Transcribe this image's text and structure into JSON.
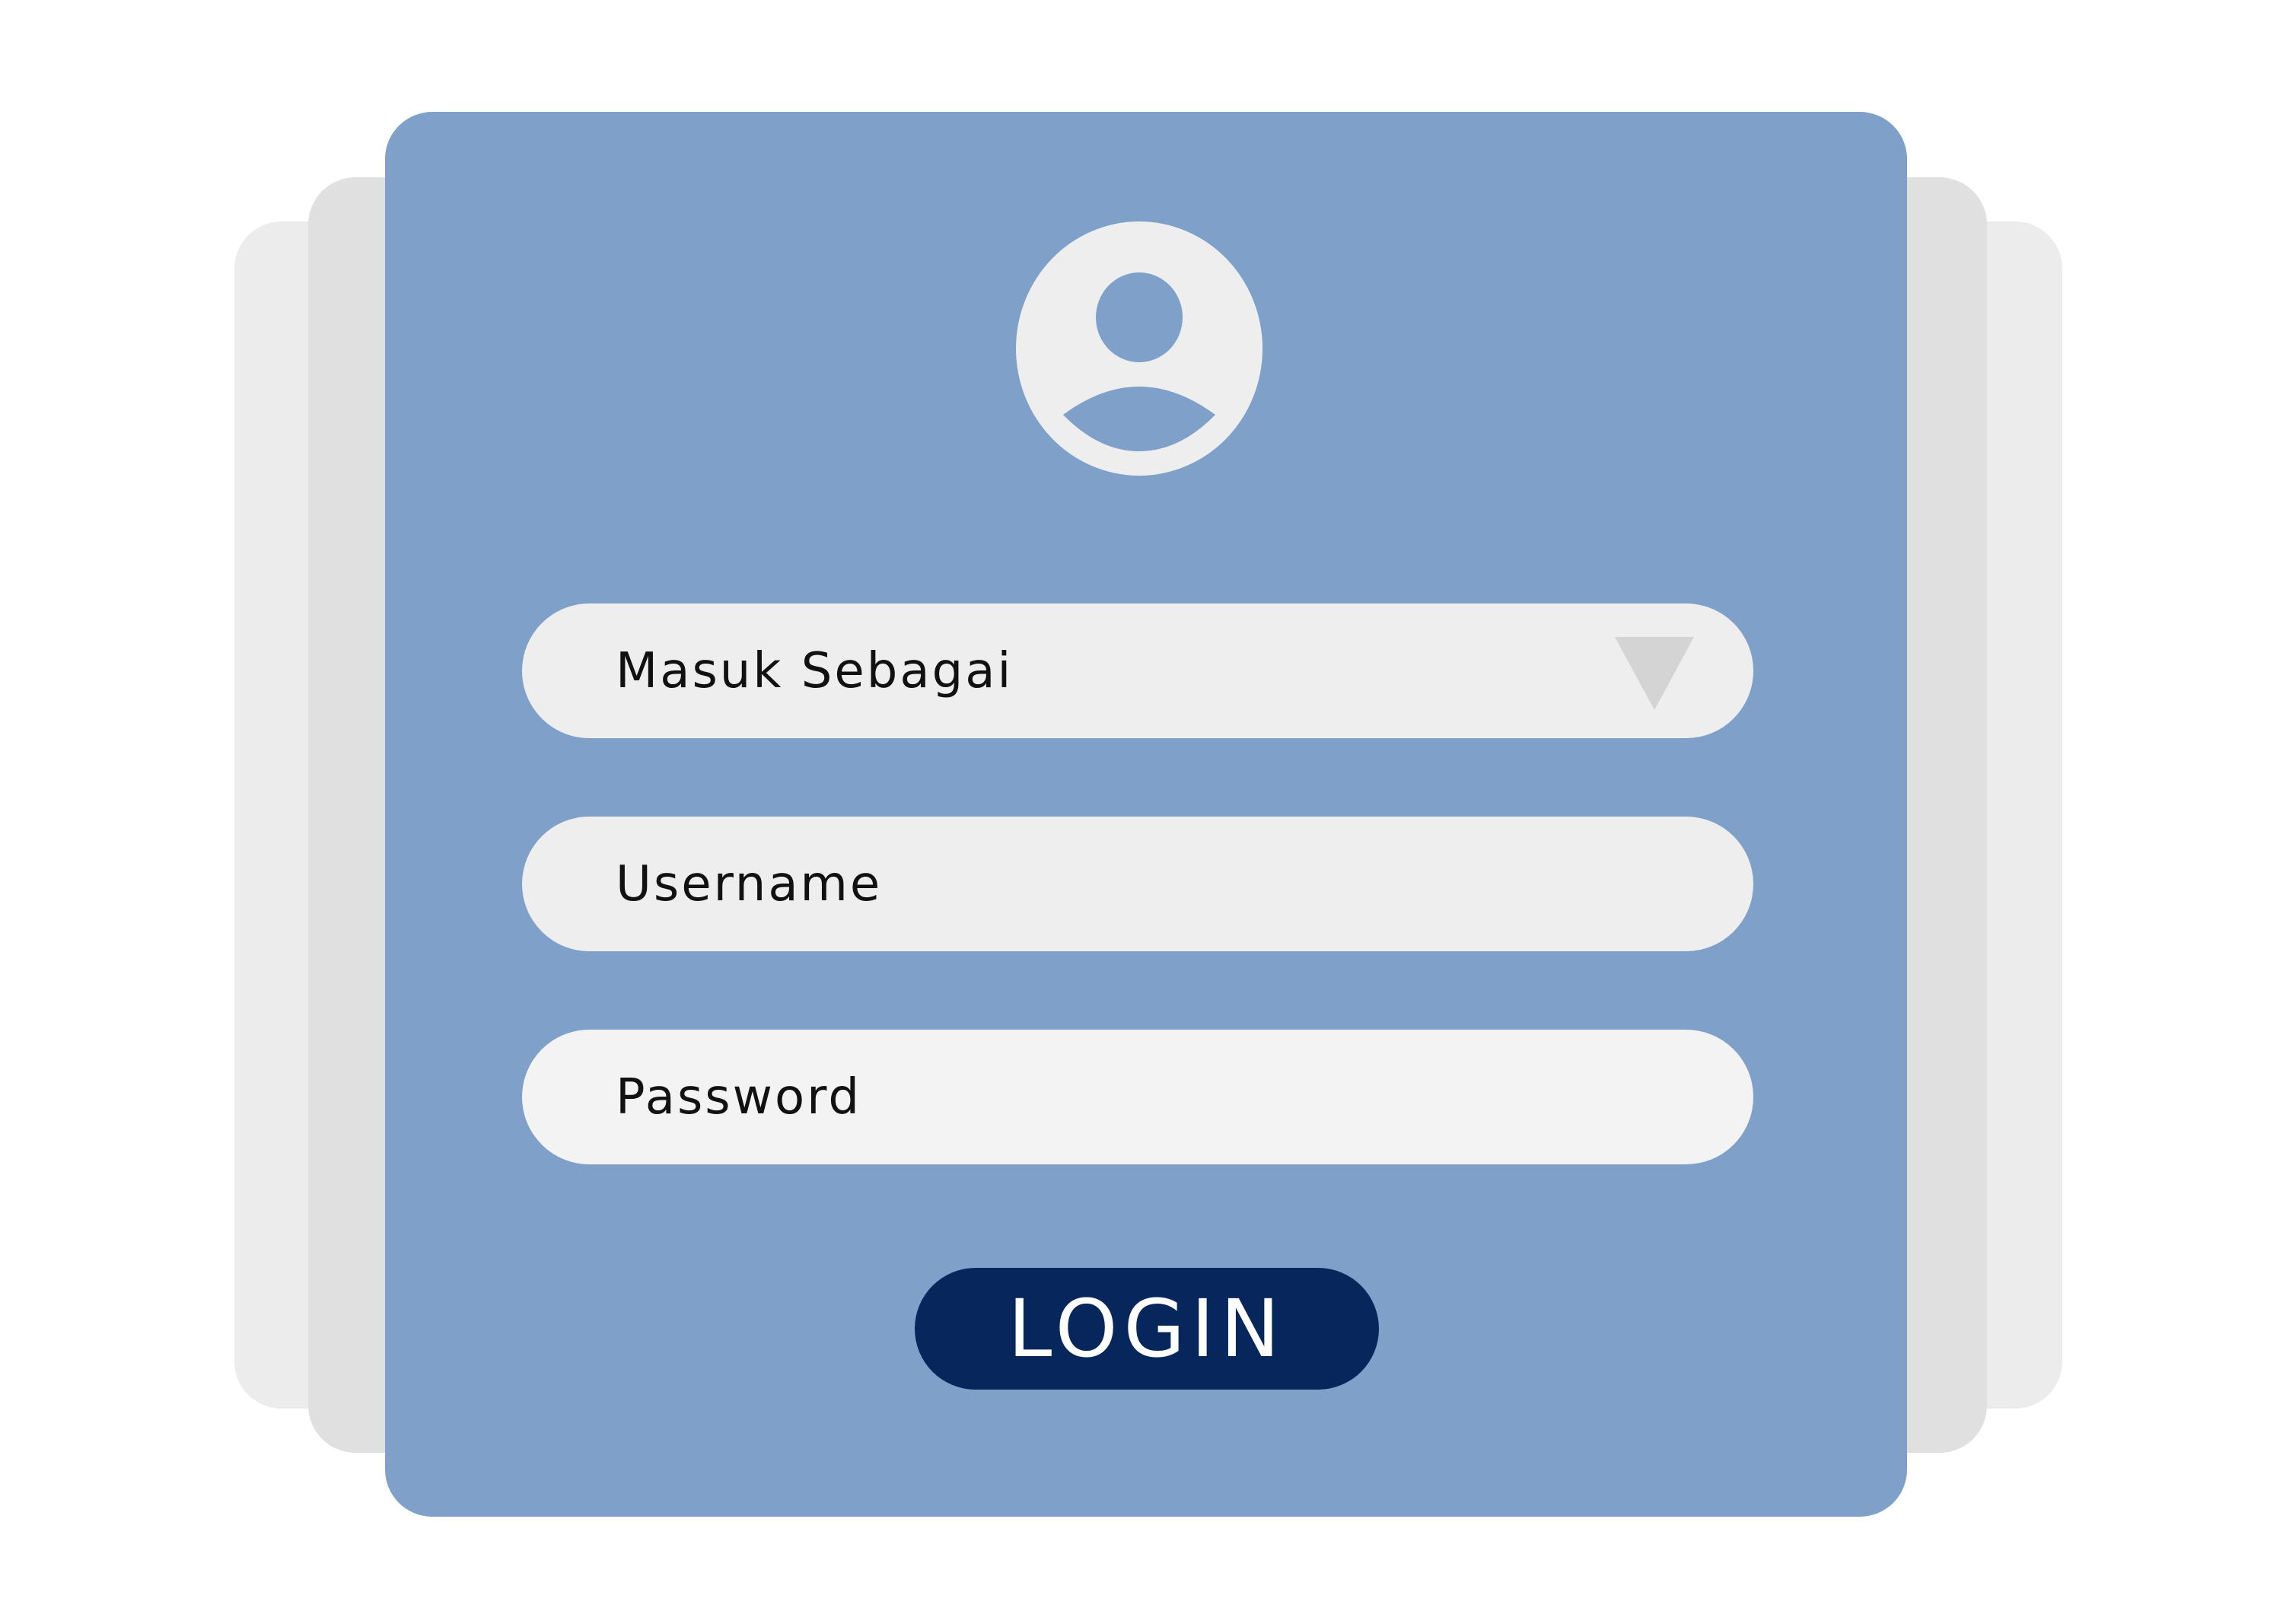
{
  "login_form": {
    "role_select": {
      "selected_label": "Masuk Sebagai",
      "dropdown_icon": "triangle-down-icon"
    },
    "username_field": {
      "placeholder": "Username"
    },
    "password_field": {
      "placeholder": "Password"
    },
    "login_button": {
      "label": "LOGIN"
    },
    "avatar_icon": "user-avatar-icon"
  },
  "colors": {
    "panel": "#7ea0c9",
    "field": "#eeeeee",
    "button": "#07275c",
    "back_card_light": "#ececec",
    "back_card_dark": "#e0e0e0",
    "caret": "#d4d4d4"
  }
}
